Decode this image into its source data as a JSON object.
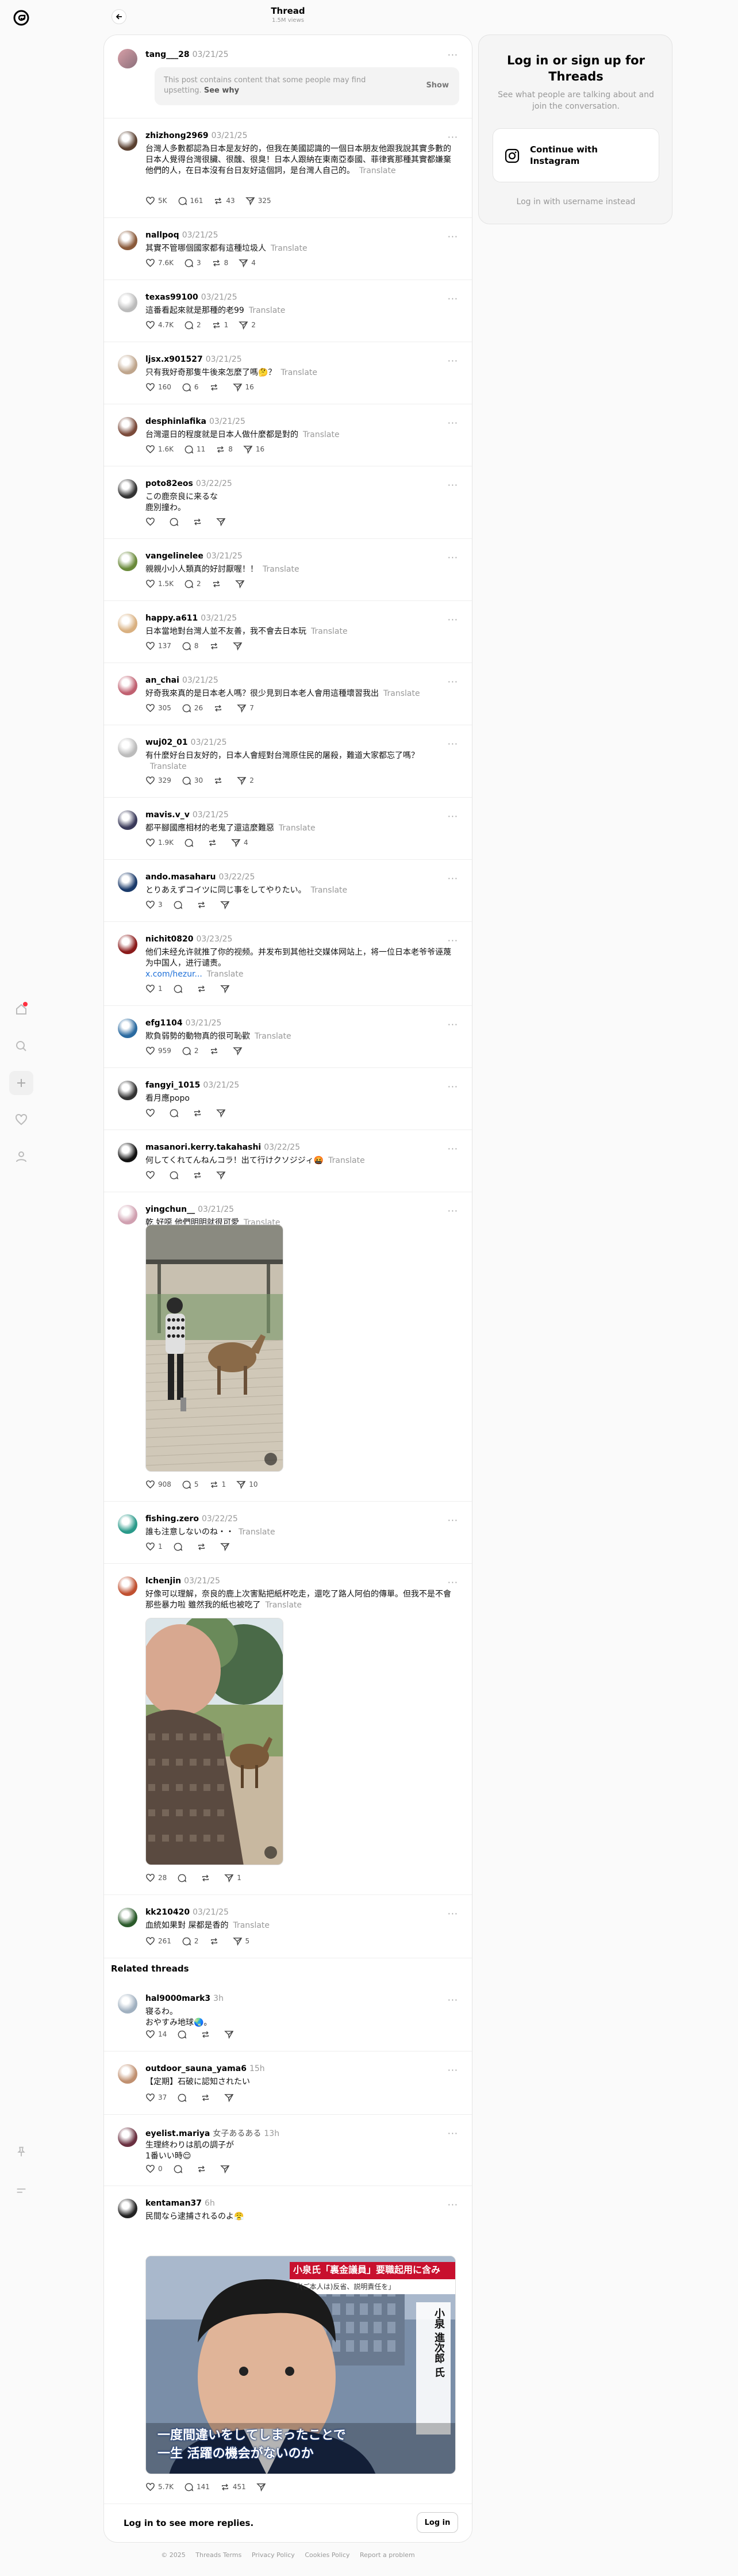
{
  "header": {
    "title": "Thread",
    "views": "1.5M views"
  },
  "sensitive": {
    "author": "tang___28",
    "time": "03/21/25",
    "text": "This post contains content that some people may find upsetting.",
    "see_why": "See why",
    "show": "Show"
  },
  "posts": [
    {
      "user": "zhizhong2969",
      "time": "03/21/25",
      "text": "台灣人多數都認為日本是友好的，但我在美國認識的一個日本朋友他跟我說其實多數的日本人覺得台灣很臟、很醜、很臭！日本人跟納在東南亞泰國、菲律賓那種其實都嫌棄他們的人，在日本沒有台日友好這個詞，是台灣人自己的。",
      "translate": "Translate",
      "likes": "5K",
      "comments": "161",
      "reposts": "43",
      "shares": "325"
    },
    {
      "user": "nallpoq",
      "time": "03/21/25",
      "text": "其實不管哪個國家都有這種垃圾人",
      "translate": "Translate",
      "likes": "7.6K",
      "comments": "3",
      "reposts": "8",
      "shares": "4"
    },
    {
      "user": "texas99100",
      "time": "03/21/25",
      "text": "這番看起來就是那種的老99",
      "translate": "Translate",
      "likes": "4.7K",
      "comments": "2",
      "reposts": "1",
      "shares": "2"
    },
    {
      "user": "ljsx.x901527",
      "time": "03/21/25",
      "text": "只有我好奇那隻牛後來怎麼了嗎🤔？",
      "translate": "Translate",
      "likes": "160",
      "comments": "6",
      "reposts": "",
      "shares": "16"
    },
    {
      "user": "desphinlafika",
      "time": "03/21/25",
      "text": "台灣還日的程度就是日本人做什麼都是對的",
      "translate": "Translate",
      "likes": "1.6K",
      "comments": "11",
      "reposts": "8",
      "shares": "16"
    },
    {
      "user": "poto82eos",
      "time": "03/22/25",
      "text": "この鹿奈良に来るな\n鹿別撞わ。",
      "translate": "",
      "likes": "",
      "comments": "",
      "reposts": "",
      "shares": ""
    },
    {
      "user": "vangelinelee",
      "time": "03/21/25",
      "text": "親親小小人類真的好討厭喔！！",
      "translate": "Translate",
      "likes": "1.5K",
      "comments": "2",
      "reposts": "",
      "shares": ""
    },
    {
      "user": "happy.a611",
      "time": "03/21/25",
      "text": "日本當地對台灣人並不友善，我不會去日本玩",
      "translate": "Translate",
      "likes": "137",
      "comments": "8",
      "reposts": "",
      "shares": ""
    },
    {
      "user": "an_chai",
      "time": "03/21/25",
      "text": "好奇我來真的是日本老人嗎？很少見到日本老人會用這種壞習我出",
      "translate": "Translate",
      "likes": "305",
      "comments": "26",
      "reposts": "",
      "shares": "7"
    },
    {
      "user": "wuj02_01",
      "time": "03/21/25",
      "text": "有什麼好台日友好的，日本人會經對台灣原住民的屠殺，難道大家都忘了嗎？",
      "translate": "Translate",
      "likes": "329",
      "comments": "30",
      "reposts": "",
      "shares": "2"
    },
    {
      "user": "mavis.v_v",
      "time": "03/21/25",
      "text": "都平腳國應相材的老鬼了還這麼難惡",
      "translate": "Translate",
      "likes": "1.9K",
      "comments": "",
      "reposts": "",
      "shares": "4"
    },
    {
      "user": "ando.masaharu",
      "time": "03/22/25",
      "text": "とりあえずコイツに同じ事をしてやりたい。",
      "translate": "Translate",
      "likes": "3",
      "comments": "",
      "reposts": "",
      "shares": ""
    },
    {
      "user": "nichit0820",
      "time": "03/23/25",
      "text": "他们未经允许就推了你的视频。并发布到其他社交媒体网站上，将一位日本老爷爷诬蔑为中国人，进行谴责。",
      "link": "x.com/hezur...",
      "translate": "Translate",
      "likes": "1",
      "comments": "",
      "reposts": "",
      "shares": ""
    },
    {
      "user": "efg1104",
      "time": "03/21/25",
      "text": "欺負弱勢的動物真的很可恥歡",
      "translate": "Translate",
      "likes": "959",
      "comments": "2",
      "reposts": "",
      "shares": ""
    },
    {
      "user": "fangyi_1015",
      "time": "03/21/25",
      "text": "看月應popo",
      "translate": "",
      "likes": "",
      "comments": "",
      "reposts": "",
      "shares": ""
    },
    {
      "user": "masanori.kerry.takahashi",
      "time": "03/22/25",
      "text": "何してくれてんねんコラ！出て行けクソジジィ🤬",
      "translate": "Translate",
      "likes": "",
      "comments": "",
      "reposts": "",
      "shares": ""
    },
    {
      "user": "yingchun__",
      "time": "03/21/25",
      "text": "乾 好噁 他們明明就很可愛",
      "translate": "Translate",
      "likes": "908",
      "comments": "5",
      "reposts": "1",
      "shares": "10"
    },
    {
      "user": "fishing.zero",
      "time": "03/22/25",
      "text": "誰も注意しないのね・・",
      "translate": "Translate",
      "likes": "1",
      "comments": "",
      "reposts": "",
      "shares": ""
    },
    {
      "user": "lchenjin",
      "time": "03/21/25",
      "text": "好像可以理解，奈良的鹿上次害點把紙杯吃走，還吃了路人阿伯的傳單。但我不是不會那些暴力啦 雖然我的紙也被吃了",
      "translate": "Translate",
      "likes": "28",
      "comments": "",
      "reposts": "",
      "shares": "1"
    },
    {
      "user": "kk210420",
      "time": "03/21/25",
      "text": "血統如果對 屎都是香的",
      "translate": "Translate",
      "likes": "261",
      "comments": "2",
      "reposts": "",
      "shares": "5"
    }
  ],
  "related": {
    "heading": "Related threads",
    "items": [
      {
        "user": "hal9000mark3",
        "time": "3h",
        "text": "寝るわ。\nおやすみ地球🌏。",
        "likes": "14",
        "comments": "",
        "reposts": "",
        "shares": ""
      },
      {
        "user": "outdoor_sauna_yama6",
        "time": "15h",
        "text": "【定期】石破に認知されたい",
        "likes": "37",
        "comments": "",
        "reposts": "",
        "shares": ""
      },
      {
        "user": "eyelist.mariya",
        "tag": "女子あるある",
        "time": "13h",
        "text": "生理終わりは肌の調子が\n1番いい時😌",
        "likes": "0",
        "comments": "",
        "reposts": "",
        "shares": ""
      },
      {
        "user": "kentaman37",
        "time": "6h",
        "text": "民間なら逮捕されるのよ😤",
        "likes": "5.7K",
        "comments": "141",
        "reposts": "451",
        "shares": ""
      }
    ]
  },
  "news_image": {
    "banner": "小泉氏「裏金議員」要職起用に含み",
    "sub": "「(ご本人は)反省、説明責任を」",
    "name": "小泉 進次郎 氏",
    "caption": "一度間違いをしてしまったことで\n一生 活躍の機会がないのか"
  },
  "more_replies": {
    "text": "Log in to see more replies.",
    "button": "Log in"
  },
  "login": {
    "title": "Log in or sign up for Threads",
    "subtitle": "See what people are talking about and join the conversation.",
    "button": "Continue with Instagram",
    "username_link": "Log in with username instead"
  },
  "footer": {
    "copyright": "© 2025",
    "terms": "Threads Terms",
    "privacy": "Privacy Policy",
    "cookies": "Cookies Policy",
    "report": "Report a problem"
  },
  "colors": {
    "accent": "#1d6fd8",
    "badge": "#ff3040"
  }
}
